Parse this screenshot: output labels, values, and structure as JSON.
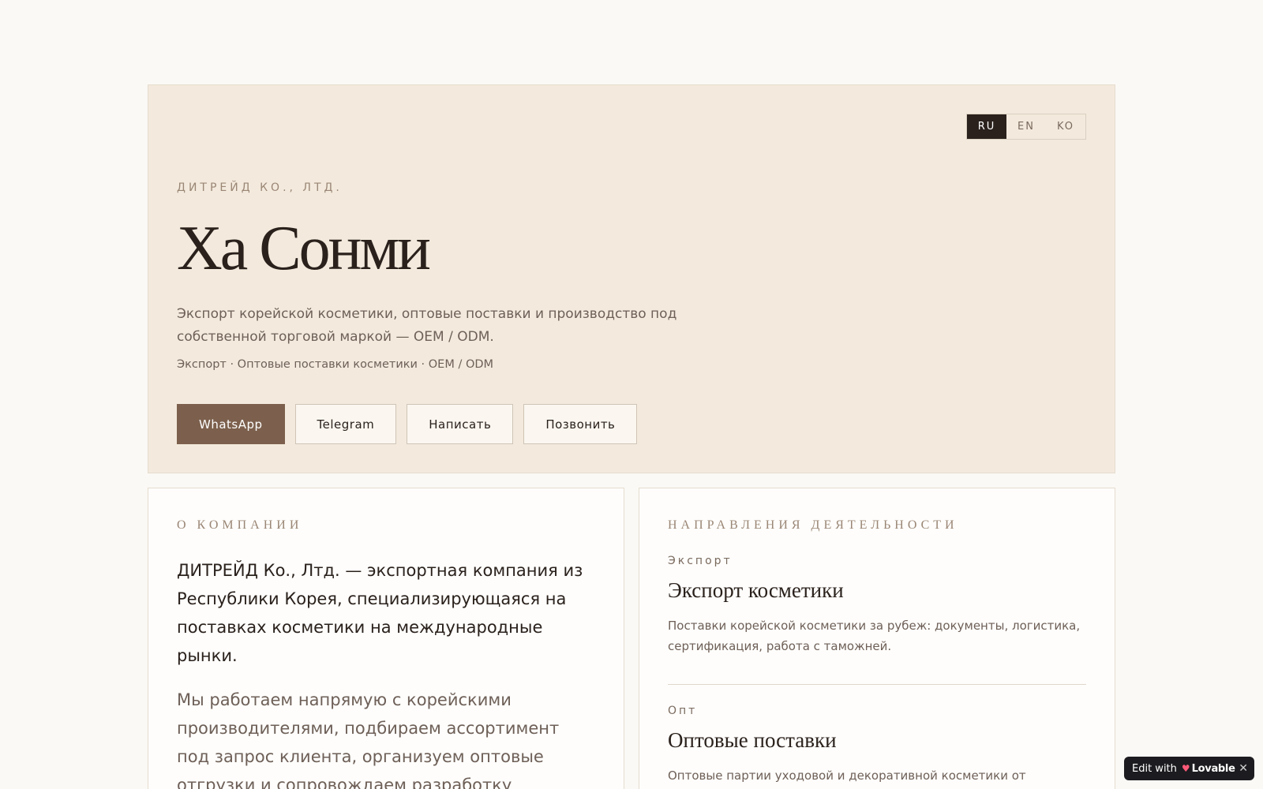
{
  "lang_switch": [
    "RU",
    "EN",
    "KO"
  ],
  "lang_active": "RU",
  "hero": {
    "company": "ДИТРЕЙД КО., ЛТД.",
    "title": "Ха Сонми",
    "description": "Экспорт корейской косметики, оптовые поставки и производство под собственной торговой маркой — OEM / ODM.",
    "tags": "Экспорт · Оптовые поставки косметики · OEM / ODM",
    "buttons": [
      "WhatsApp",
      "Telegram",
      "Написать",
      "Позвонить"
    ]
  },
  "about": {
    "label": "О КОМПАНИИ",
    "lead": "ДИТРЕЙД Ко., Лтд. — экспортная компания из Республики Корея, специализирующаяся на поставках косметики на международные рынки.",
    "body": "Мы работаем напрямую с корейскими производителями, подбираем ассортимент под запрос клиента, организуем оптовые отгрузки и сопровождаем разработку продукта под"
  },
  "directions": {
    "label": "НАПРАВЛЕНИЯ ДЕЯТЕЛЬНОСТИ",
    "items": [
      {
        "kicker": "Экспорт",
        "title": "Экспорт косметики",
        "text": "Поставки корейской косметики за рубеж: документы, логистика, сертификация, работа с таможней."
      },
      {
        "kicker": "Опт",
        "title": "Оптовые поставки",
        "text": "Оптовые партии уходовой и декоративной косметики от"
      }
    ]
  },
  "badge": {
    "prefix": "Edit with",
    "brand": "Lovable",
    "close": "✕"
  }
}
